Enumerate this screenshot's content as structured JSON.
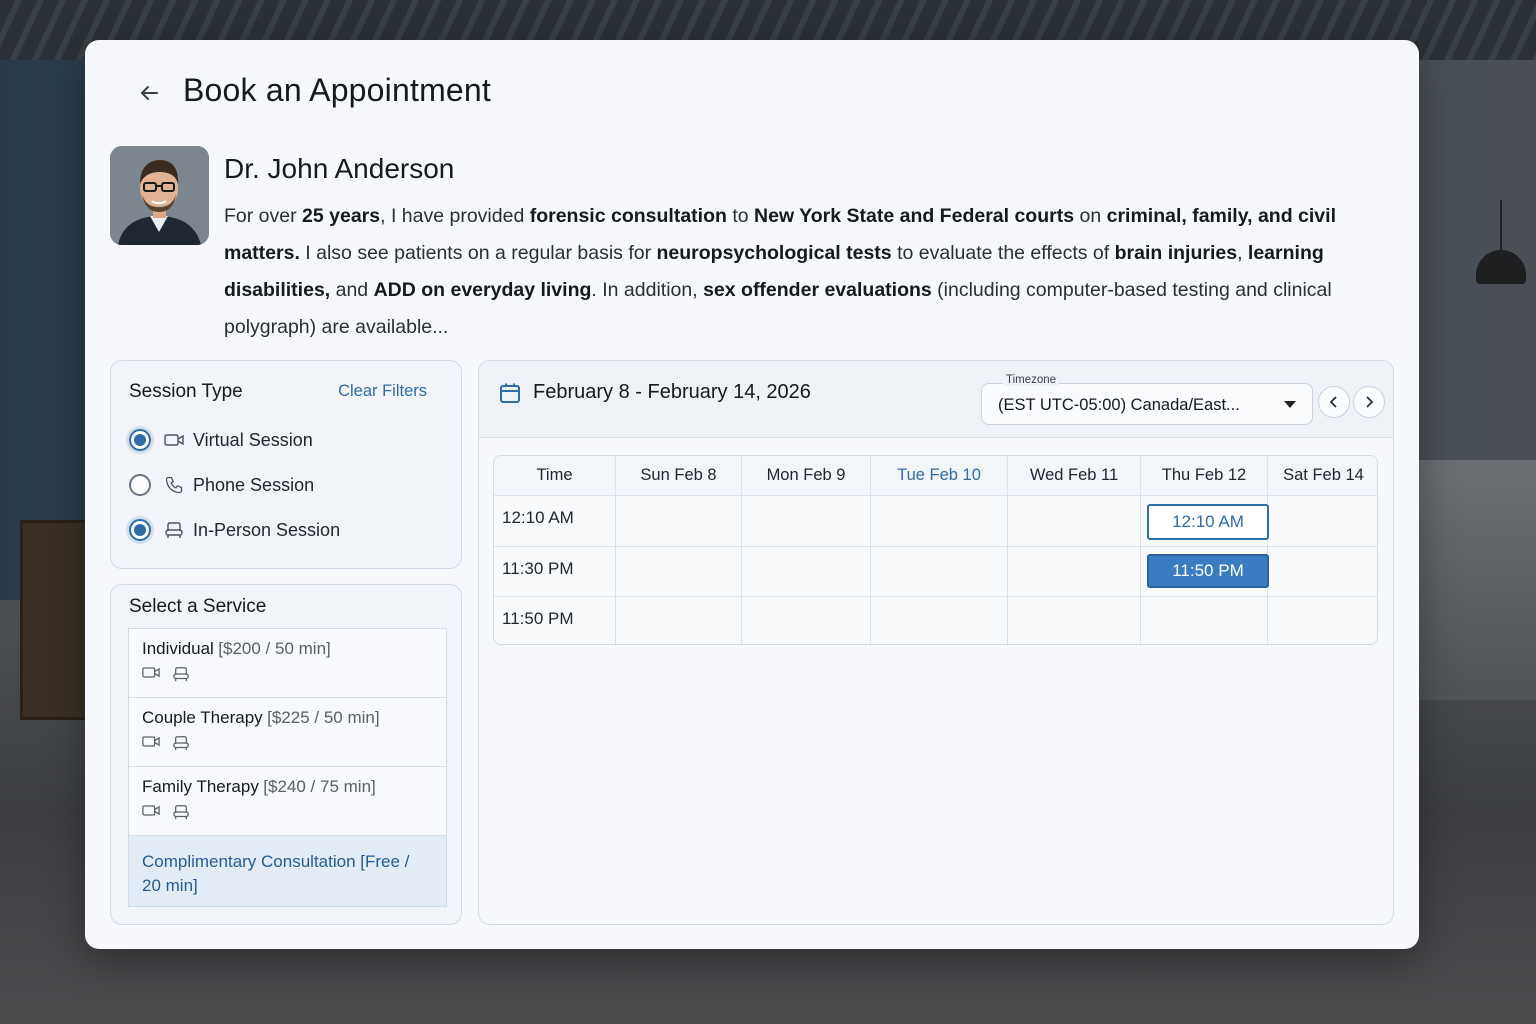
{
  "page": {
    "title": "Book an Appointment"
  },
  "doctor": {
    "name": "Dr. John Anderson",
    "bio": [
      {
        "t": "For over ",
        "b": false
      },
      {
        "t": "25 years",
        "b": true
      },
      {
        "t": ", I have provided ",
        "b": false
      },
      {
        "t": "forensic consultation",
        "b": true
      },
      {
        "t": " to ",
        "b": false
      },
      {
        "t": "New York State and Federal courts",
        "b": true
      },
      {
        "t": " on ",
        "b": false
      },
      {
        "t": "criminal, family, and civil matters.",
        "b": true
      },
      {
        "t": " I also see patients on a regular basis for ",
        "b": false
      },
      {
        "t": "neuropsychological tests",
        "b": true
      },
      {
        "t": " to evaluate the effects of ",
        "b": false
      },
      {
        "t": "brain injuries",
        "b": true
      },
      {
        "t": ", ",
        "b": false
      },
      {
        "t": "learning disabilities,",
        "b": true
      },
      {
        "t": " and ",
        "b": false
      },
      {
        "t": "ADD on everyday living",
        "b": true
      },
      {
        "t": ". In addition, ",
        "b": false
      },
      {
        "t": "sex offender evaluations",
        "b": true
      },
      {
        "t": " (including computer-based testing and clinical polygraph) are available...",
        "b": false
      }
    ]
  },
  "session_type": {
    "title": "Session Type",
    "clear_label": "Clear Filters",
    "options": [
      {
        "label": "Virtual Session",
        "checked": true,
        "icon": "video-icon"
      },
      {
        "label": "Phone Session",
        "checked": false,
        "icon": "phone-icon"
      },
      {
        "label": "In-Person Session",
        "checked": true,
        "icon": "chair-icon"
      }
    ]
  },
  "services": {
    "title": "Select a Service",
    "items": [
      {
        "name": "Individual",
        "price": "[$200 / 50 min]",
        "selected": false
      },
      {
        "name": "Couple Therapy",
        "price": "[$225 / 50 min]",
        "selected": false
      },
      {
        "name": "Family Therapy",
        "price": "[$240 / 75 min]",
        "selected": false
      },
      {
        "name": "Complimentary Consultation [Free / 20 min]",
        "price": "",
        "selected": true
      }
    ]
  },
  "calendar": {
    "week_range": "February 8 - February 14, 2026",
    "timezone_label": "Timezone",
    "timezone_value": "(EST UTC-05:00) Canada/East...",
    "columns": [
      "Time",
      "Sun Feb 8",
      "Mon Feb 9",
      "Tue Feb 10",
      "Wed Feb 11",
      "Thu Feb 12",
      "Sat Feb 14"
    ],
    "today_index": 3,
    "rows": [
      "12:10 AM",
      "11:30 PM",
      "11:50 PM"
    ],
    "slots": [
      {
        "label": "12:10 AM",
        "row": 0,
        "col": 5,
        "style": "outline"
      },
      {
        "label": "11:50 PM",
        "row": 1,
        "col": 5,
        "style": "filled"
      }
    ]
  },
  "colors": {
    "accent": "#2f6ca8",
    "selected_bg": "#e3ecf6",
    "slot_filled": "#3a7cc1"
  }
}
